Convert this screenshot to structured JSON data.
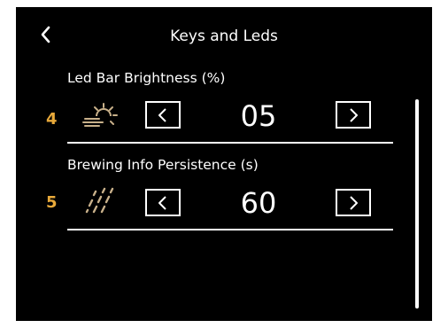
{
  "header": {
    "title": "Keys and Leds"
  },
  "settings": [
    {
      "number": "4",
      "label": "Led Bar Brightness (%)",
      "icon": "sun-brightness-icon",
      "value": "05"
    },
    {
      "number": "5",
      "label": "Brewing Info Persistence (s)",
      "icon": "diagonal-dashes-icon",
      "value": "60"
    }
  ],
  "colors": {
    "background": "#000000",
    "text": "#ffffff",
    "accent_number": "#e8a93a"
  }
}
